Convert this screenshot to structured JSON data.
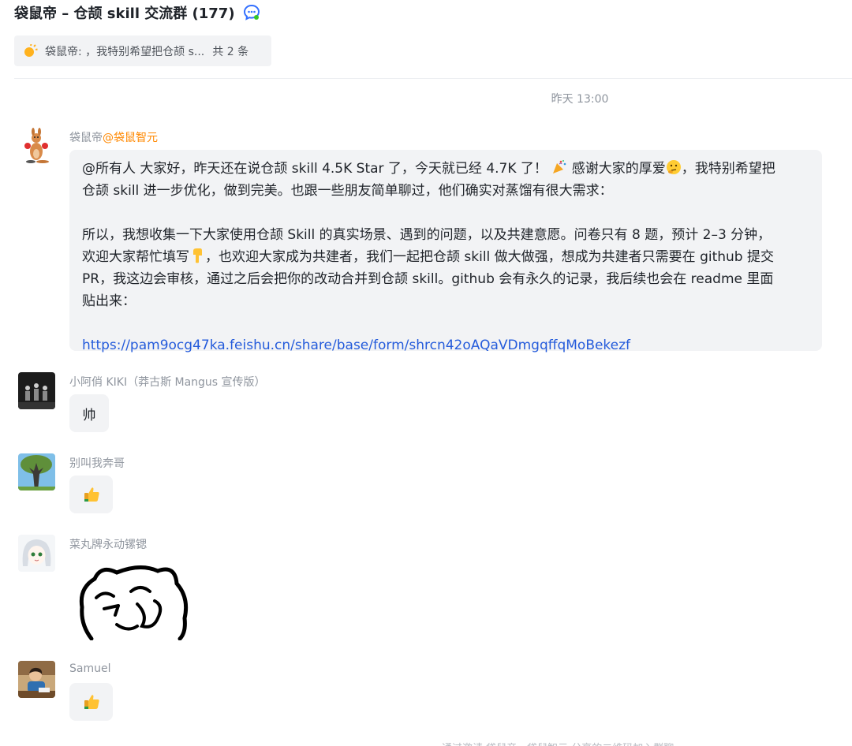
{
  "header": {
    "title": "袋鼠帝 – 仓颉 skill 交流群 (177)",
    "chat_icon": "chat-bubble-icon"
  },
  "pinned": {
    "icon": "sun-emoji-icon",
    "preview": "袋鼠帝: ，我特别希望把仓颉 s...",
    "count": "共 2 条"
  },
  "timestamp": "昨天 13:00",
  "messages": [
    {
      "sender": "袋鼠帝",
      "mention_tag": "@袋鼠智元",
      "avatar": "kangaroo-boxing-avatar",
      "paragraph1_a": "@所有人 大家好，昨天还在说仓颉 skill 4.5K Star 了，今天就已经 4.7K 了！",
      "paragraph1_b": "感谢大家的厚爱",
      "paragraph1_c": "，我特别希望把",
      "paragraph1_d": "仓颉 skill 进一步优化，做到完美。也跟一些朋友简单聊过，他们确实对蒸馏有很大需求：",
      "paragraph2_a": "所以，我想收集一下大家使用仓颉 Skill 的真实场景、遇到的问题，以及共建意愿。问卷只有 8 题，预计 2–3 分钟，",
      "paragraph2_b": "欢迎大家帮忙填写",
      "paragraph2_c": "，也欢迎大家成为共建者，我们一起把仓颉 skill 做大做强，想成为共建者只需要在 github 提交",
      "paragraph2_d": "PR，我这边会审核，通过之后会把你的改动合并到仓颉 skill。github 会有永久的记录，我后续也会在 readme 里面",
      "paragraph2_e": "贴出来：",
      "link": "https://pam9ocg47ka.feishu.cn/share/base/form/shrcn42oAQaVDmgqffqMoBekezf"
    },
    {
      "sender": "小阿俏 KIKI（莽古斯 Mangus 宣传版）",
      "avatar": "group-photo-avatar",
      "text": "帅"
    },
    {
      "sender": "别叫我奔哥",
      "avatar": "tree-avatar",
      "reaction": "thumbs-up-emoji"
    },
    {
      "sender": "菜丸牌永动镙锶",
      "avatar": "anime-girl-avatar",
      "sticker": "bear-sticker"
    },
    {
      "sender": "Samuel",
      "avatar": "boy-desk-avatar",
      "reaction": "thumbs-up-emoji"
    }
  ],
  "footer_partial": "通过邀请 袋鼠帝、袋鼠智元 分享的二维码加入群聊"
}
